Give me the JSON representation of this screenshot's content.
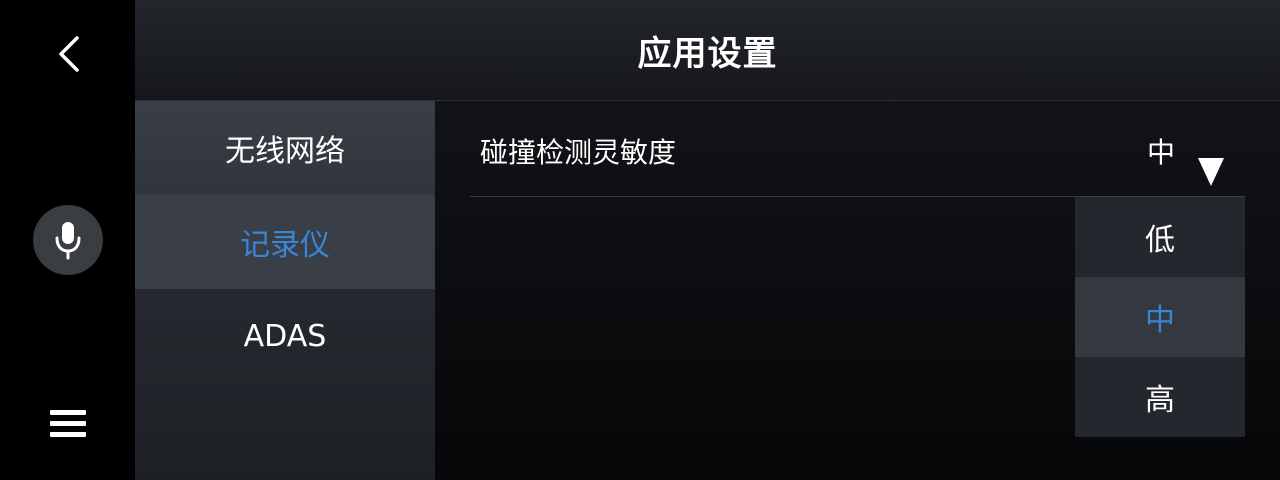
{
  "header": {
    "title": "应用设置"
  },
  "rail": {
    "back_icon": "chevron-left-icon",
    "mic_icon": "microphone-icon",
    "menu_icon": "hamburger-menu-icon"
  },
  "categories": [
    {
      "label": "无线网络",
      "active": false
    },
    {
      "label": "记录仪",
      "active": true
    },
    {
      "label": "ADAS",
      "active": false
    }
  ],
  "setting": {
    "label": "碰撞检测灵敏度",
    "value": "中",
    "dropdown_icon": "triangle-down-icon"
  },
  "dropdown": {
    "options": [
      {
        "label": "低",
        "selected": false
      },
      {
        "label": "中",
        "selected": true
      },
      {
        "label": "高",
        "selected": false
      }
    ]
  },
  "colors": {
    "accent": "#3a86d6",
    "text": "#ffffff"
  }
}
